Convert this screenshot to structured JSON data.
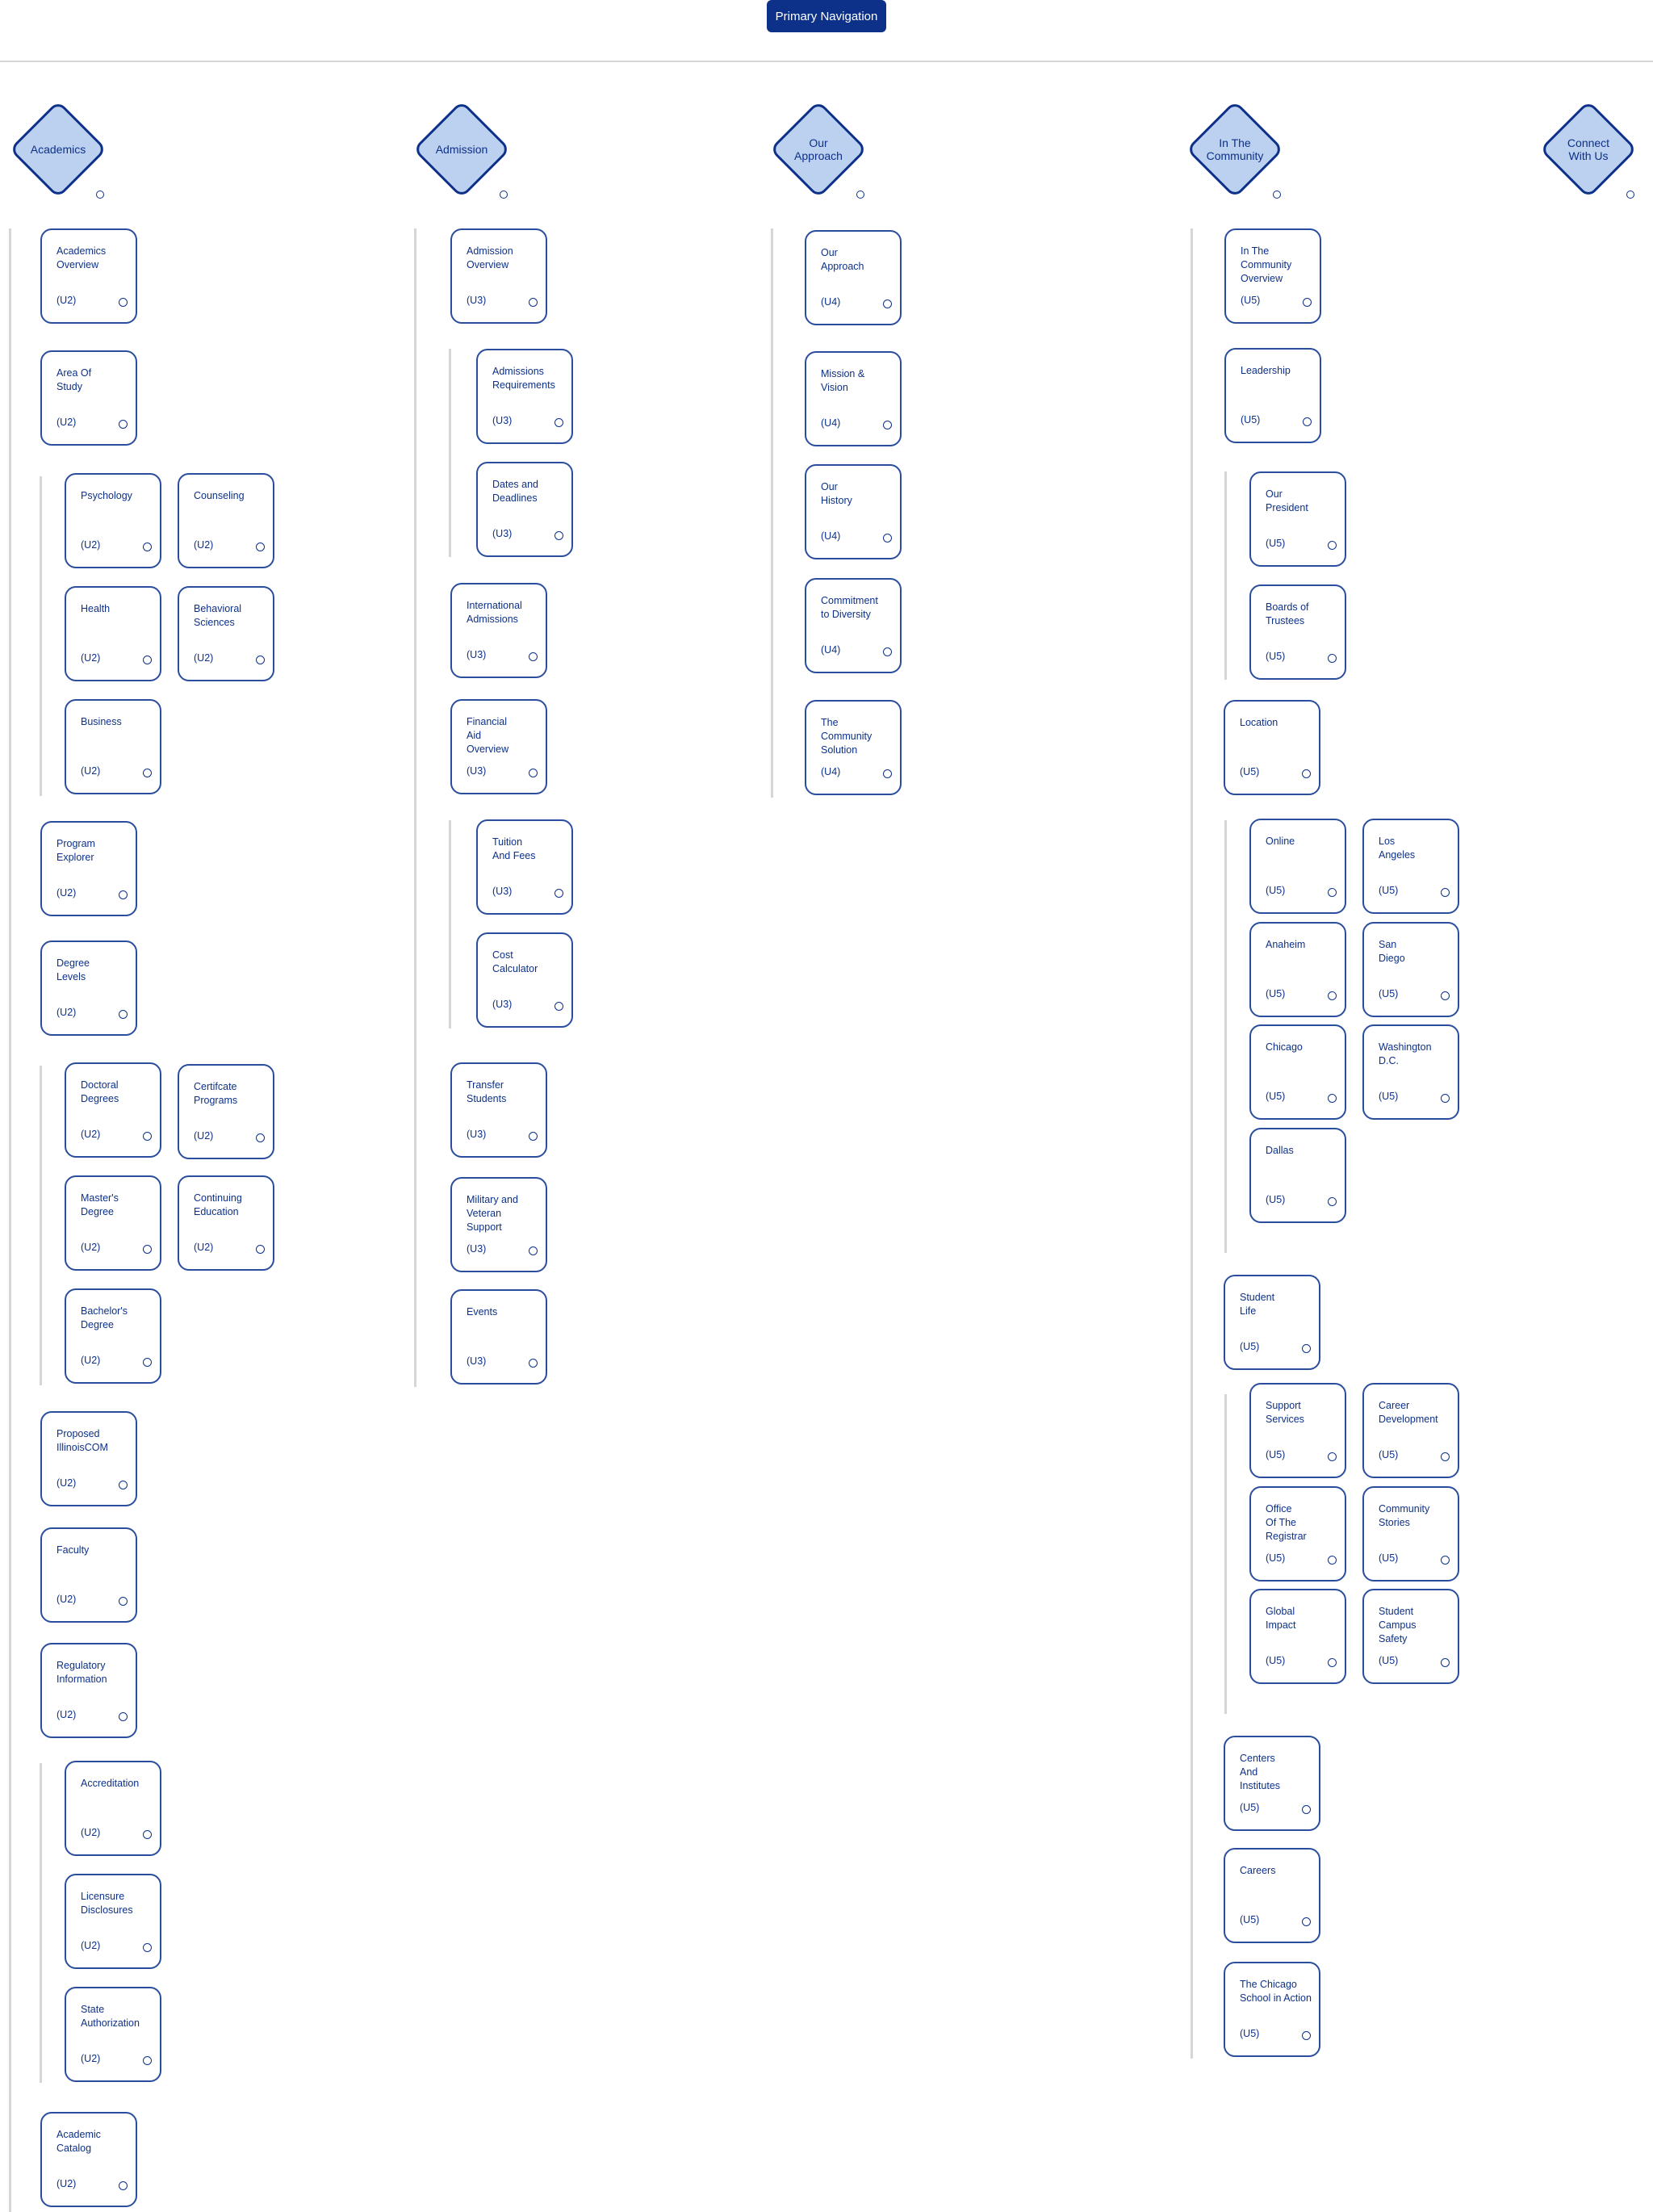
{
  "header": {
    "title": "Primary Navigation"
  },
  "colors": {
    "brand": "#0d3189",
    "diamond_fill": "#bcd0ef",
    "card_border": "#2a4d9e",
    "connector": "#d6d6d6"
  },
  "sections": [
    {
      "label": "Academics",
      "code": "U2"
    },
    {
      "label": "Admission",
      "code": "U3"
    },
    {
      "label": "Our\nApproach",
      "code": "U4"
    },
    {
      "label": "In The\nCommunity",
      "code": "U5"
    },
    {
      "label": "Connect\nWith Us",
      "code": ""
    }
  ],
  "academics": {
    "overview": {
      "title": "Academics\nOverview",
      "code": "(U2)"
    },
    "area_of_study": {
      "title": "Area Of\nStudy",
      "code": "(U2)",
      "children": [
        {
          "title": "Psychology",
          "code": "(U2)"
        },
        {
          "title": "Counseling",
          "code": "(U2)"
        },
        {
          "title": "Health",
          "code": "(U2)"
        },
        {
          "title": "Behavioral\nSciences",
          "code": "(U2)"
        },
        {
          "title": "Business",
          "code": "(U2)"
        }
      ]
    },
    "program_explorer": {
      "title": "Program\nExplorer",
      "code": "(U2)"
    },
    "degree_levels": {
      "title": "Degree\nLevels",
      "code": "(U2)",
      "children": [
        {
          "title": "Doctoral\nDegrees",
          "code": "(U2)"
        },
        {
          "title": "Certifcate\nPrograms",
          "code": "(U2)"
        },
        {
          "title": "Master's\nDegree",
          "code": "(U2)"
        },
        {
          "title": "Continuing\nEducation",
          "code": "(U2)"
        },
        {
          "title": "Bachelor's\nDegree",
          "code": "(U2)"
        }
      ]
    },
    "proposed": {
      "title": "Proposed\nIllinoisCOM",
      "code": "(U2)"
    },
    "faculty": {
      "title": "Faculty",
      "code": "(U2)"
    },
    "regulatory": {
      "title": "Regulatory\nInformation",
      "code": "(U2)",
      "children": [
        {
          "title": "Accreditation",
          "code": "(U2)"
        },
        {
          "title": "Licensure\nDisclosures",
          "code": "(U2)"
        },
        {
          "title": "State\nAuthorization",
          "code": "(U2)"
        }
      ]
    },
    "catalog": {
      "title": "Academic\nCatalog",
      "code": "(U2)"
    }
  },
  "admission": {
    "overview": {
      "title": "Admission\nOverview",
      "code": "(U3)",
      "children": [
        {
          "title": "Admissions\nRequirements",
          "code": "(U3)"
        },
        {
          "title": "Dates and\nDeadlines",
          "code": "(U3)"
        }
      ]
    },
    "international": {
      "title": "International\nAdmissions",
      "code": "(U3)"
    },
    "financial_aid": {
      "title": "Financial\nAid\nOverview",
      "code": "(U3)",
      "children": [
        {
          "title": "Tuition\nAnd Fees",
          "code": "(U3)"
        },
        {
          "title": "Cost\nCalculator",
          "code": "(U3)"
        }
      ]
    },
    "transfer": {
      "title": "Transfer\nStudents",
      "code": "(U3)"
    },
    "military": {
      "title": "Military and\nVeteran\nSupport",
      "code": "(U3)"
    },
    "events": {
      "title": "Events",
      "code": "(U3)"
    }
  },
  "our_approach": {
    "items": [
      {
        "title": "Our\nApproach",
        "code": "(U4)"
      },
      {
        "title": "Mission &\nVision",
        "code": "(U4)"
      },
      {
        "title": "Our\nHistory",
        "code": "(U4)"
      },
      {
        "title": "Commitment\nto Diversity",
        "code": "(U4)"
      },
      {
        "title": "The\nCommunity\nSolution",
        "code": "(U4)"
      }
    ]
  },
  "community": {
    "overview": {
      "title": "In The\nCommunity\nOverview",
      "code": "(U5)"
    },
    "leadership": {
      "title": "Leadership",
      "code": "(U5)",
      "children": [
        {
          "title": "Our\nPresident",
          "code": "(U5)"
        },
        {
          "title": "Boards of\nTrustees",
          "code": "(U5)"
        }
      ]
    },
    "location": {
      "title": "Location",
      "code": "(U5)",
      "children": [
        {
          "title": "Online",
          "code": "(U5)"
        },
        {
          "title": "Los\nAngeles",
          "code": "(U5)"
        },
        {
          "title": "Anaheim",
          "code": "(U5)"
        },
        {
          "title": "San\nDiego",
          "code": "(U5)"
        },
        {
          "title": "Chicago",
          "code": "(U5)"
        },
        {
          "title": "Washington\nD.C.",
          "code": "(U5)"
        },
        {
          "title": "Dallas",
          "code": "(U5)"
        }
      ]
    },
    "student_life": {
      "title": "Student\nLife",
      "code": "(U5)",
      "children": [
        {
          "title": "Support\nServices",
          "code": "(U5)"
        },
        {
          "title": "Career\nDevelopment",
          "code": "(U5)"
        },
        {
          "title": "Office\nOf The\nRegistrar",
          "code": "(U5)"
        },
        {
          "title": "Community\nStories",
          "code": "(U5)"
        },
        {
          "title": "Global\nImpact",
          "code": "(U5)"
        },
        {
          "title": "Student\nCampus\nSafety",
          "code": "(U5)"
        }
      ]
    },
    "centers": {
      "title": "Centers\nAnd\nInstitutes",
      "code": "(U5)"
    },
    "careers": {
      "title": "Careers",
      "code": "(U5)"
    },
    "chicago_school": {
      "title": "The Chicago\nSchool in Action",
      "code": "(U5)"
    }
  }
}
